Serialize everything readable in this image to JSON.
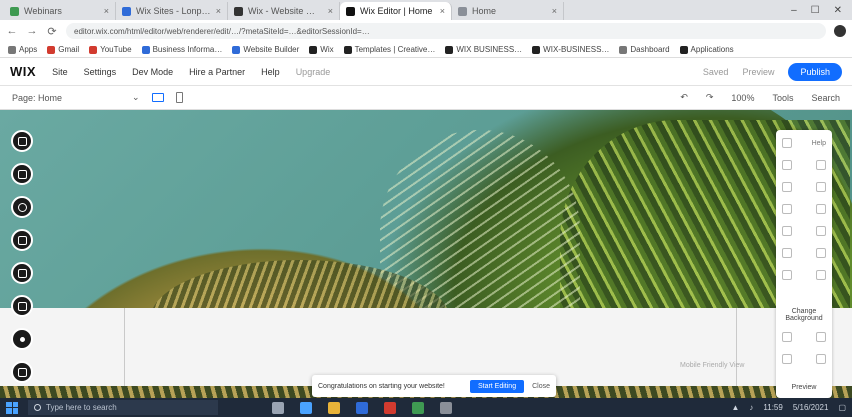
{
  "browser": {
    "tabs": [
      {
        "label": "Webinars",
        "fav": "green",
        "active": false
      },
      {
        "label": "Wix Sites - Lonpi Lab",
        "fav": "blue",
        "active": false
      },
      {
        "label": "Wix - Website Wizard",
        "fav": "dark",
        "active": false
      },
      {
        "label": "Wix Editor | Home",
        "fav": "wix",
        "active": true
      },
      {
        "label": "Home",
        "fav": "",
        "active": false
      }
    ],
    "tab_close": "×",
    "window_controls": [
      "–",
      "☐",
      "✕"
    ],
    "nav": [
      "←",
      "→",
      "⟳"
    ],
    "url": "editor.wix.com/html/editor/web/renderer/edit/…/?metaSiteId=…&editorSessionId=…",
    "bookmarks": [
      {
        "label": "Apps",
        "fav": ""
      },
      {
        "label": "Gmail",
        "fav": "red"
      },
      {
        "label": "YouTube",
        "fav": "red"
      },
      {
        "label": "Business Informa…",
        "fav": "blue"
      },
      {
        "label": "Website Builder",
        "fav": "blue"
      },
      {
        "label": "Wix",
        "fav": "dark"
      },
      {
        "label": "Templates | Creative…",
        "fav": "dark"
      },
      {
        "label": "WIX BUSINESS…",
        "fav": "dark"
      },
      {
        "label": "WIX-BUSINESS…",
        "fav": "dark"
      },
      {
        "label": "Dashboard",
        "fav": ""
      },
      {
        "label": "Applications",
        "fav": "dark"
      }
    ]
  },
  "wix": {
    "logo": "WIX",
    "menu": [
      "Site",
      "Settings",
      "Dev Mode",
      "Hire a Partner",
      "Help",
      "Upgrade"
    ],
    "right": {
      "save": "Saved",
      "preview": "Preview",
      "publish": "Publish"
    }
  },
  "pagebar": {
    "page": "Page: Home",
    "chevron": "⌄",
    "undo": "↶",
    "redo": "↷",
    "zoom": "100%",
    "tools": "Tools",
    "search": "Search"
  },
  "rightpanel": {
    "top": "Help",
    "section_label": "Change Background",
    "bottom_label": "Preview"
  },
  "toast": {
    "message": "Congratulations on starting your website!",
    "cta": "Start Editing",
    "later": "Close"
  },
  "canvas_hint": "Mobile Friendly View",
  "taskbar": {
    "search_placeholder": "Type here to search",
    "time": "11:59",
    "date": "5/16/2021"
  },
  "colors": {
    "accent": "#116dff",
    "taskbar": "#1f2a3a"
  }
}
